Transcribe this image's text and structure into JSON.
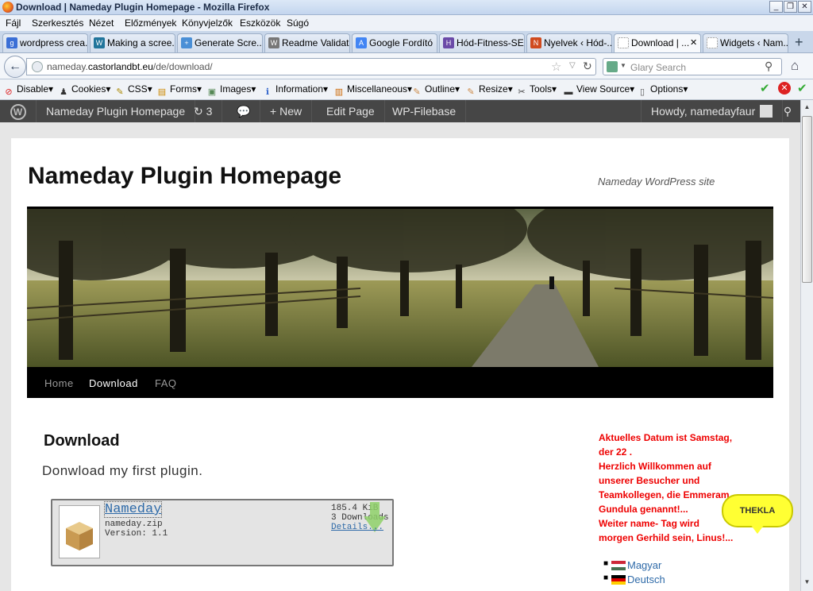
{
  "window": {
    "title": "Download | Nameday Plugin Homepage - Mozilla Firefox",
    "buttons": [
      "_",
      "❐",
      "✕"
    ]
  },
  "menubar": [
    "Fájl",
    "Szerkesztés",
    "Nézet",
    "Előzmények",
    "Könyvjelzők",
    "Eszközök",
    "Súgó"
  ],
  "tabs": [
    {
      "label": "wordpress crea...",
      "icon": "google-icon",
      "color": "#3b6fd6",
      "glyph": "g"
    },
    {
      "label": "Making a scree...",
      "icon": "wordpress-icon",
      "color": "#21759b",
      "glyph": "W"
    },
    {
      "label": "Generate Scre...",
      "icon": "plugin-icon",
      "color": "#4a8fd6",
      "glyph": "+"
    },
    {
      "label": "Readme Validat...",
      "icon": "wordpress-icon",
      "color": "#777777",
      "glyph": "W"
    },
    {
      "label": "Google Fordító",
      "icon": "translate-icon",
      "color": "#4285f4",
      "glyph": "A"
    },
    {
      "label": "Hód-Fitness-SE",
      "icon": "beaver-icon",
      "color": "#6b4aa8",
      "glyph": "H"
    },
    {
      "label": "Nyelvek ‹ Hód-...",
      "icon": "admin-icon",
      "color": "#d04a1e",
      "glyph": "N"
    },
    {
      "label": "Download | ...",
      "icon": "page-icon",
      "color": "#ffffff",
      "glyph": "",
      "active": true
    },
    {
      "label": "Widgets ‹ Nam...",
      "icon": "page-icon",
      "color": "#ffffff",
      "glyph": ""
    }
  ],
  "tab_close": "✕",
  "new_tab": "+",
  "navbar": {
    "url_prefix": "nameday.",
    "url_host": "castorlandbt.eu",
    "url_path": "/de/download/",
    "search_placeholder": "Glary Search"
  },
  "webdev": [
    {
      "label": "Disable",
      "icon": "disable-icon",
      "glyph": "⊘",
      "color": "#d22"
    },
    {
      "label": "Cookies",
      "icon": "cookies-icon",
      "glyph": "♟",
      "color": "#333"
    },
    {
      "label": "CSS",
      "icon": "css-icon",
      "glyph": "✎",
      "color": "#a80"
    },
    {
      "label": "Forms",
      "icon": "forms-icon",
      "glyph": "▤",
      "color": "#c80"
    },
    {
      "label": "Images",
      "icon": "images-icon",
      "glyph": "▣",
      "color": "#585"
    },
    {
      "label": "Information",
      "icon": "information-icon",
      "glyph": "ℹ",
      "color": "#36c"
    },
    {
      "label": "Miscellaneous",
      "icon": "miscellaneous-icon",
      "glyph": "▥",
      "color": "#c60"
    },
    {
      "label": "Outline",
      "icon": "outline-icon",
      "glyph": "✎",
      "color": "#c84"
    },
    {
      "label": "Resize",
      "icon": "resize-icon",
      "glyph": "✎",
      "color": "#c84"
    },
    {
      "label": "Tools",
      "icon": "tools-icon",
      "glyph": "✂",
      "color": "#444"
    },
    {
      "label": "View Source",
      "icon": "view-source-icon",
      "glyph": "▬",
      "color": "#333"
    },
    {
      "label": "Options",
      "icon": "options-icon",
      "glyph": "▯",
      "color": "#555"
    }
  ],
  "adminbar": {
    "site": "Nameday Plugin Homepage",
    "updates": "3",
    "new": "New",
    "edit": "Edit Page",
    "filebase": "WP-Filebase",
    "howdy": "Howdy, namedayfaur"
  },
  "site": {
    "title": "Nameday Plugin Homepage",
    "description": "Nameday WordPress site",
    "nav": [
      "Home",
      "Download",
      "FAQ"
    ]
  },
  "content": {
    "title": "Download",
    "text": "Donwload my first plugin.",
    "file": {
      "name": "Nameday",
      "filename": "nameday.zip",
      "version": "Version: 1.1",
      "size": "185.4 KiB",
      "downloads": "3 Downloads",
      "details": "Details..."
    }
  },
  "sidebar": {
    "lines": [
      "Aktuelles Datum ist Samstag,",
      "der 22 .",
      "Herzlich Willkommen auf",
      "unserer Besucher und",
      "Teamkollegen, die Emmeram",
      "Gundula genannt!...",
      "Weiter name- Tag wird",
      "morgen Gerhild sein, Linus!..."
    ],
    "languages": [
      {
        "label": "Magyar",
        "flag": "hungary-flag-icon"
      },
      {
        "label": "Deutsch",
        "flag": "germany-flag-icon"
      }
    ],
    "bubble": "THEKLA"
  }
}
